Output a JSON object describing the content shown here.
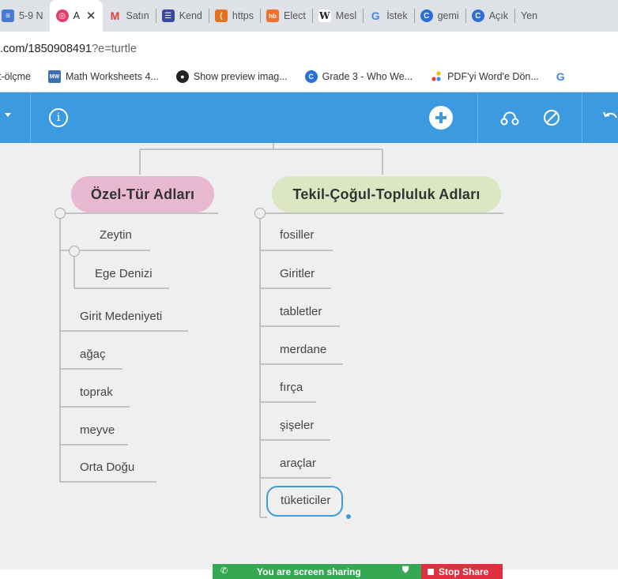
{
  "browser": {
    "tabs": [
      {
        "label": "5-9 N",
        "icon": "doc-icon",
        "color": "#4a7ad8"
      },
      {
        "label": "A",
        "icon": "app-icon",
        "color": "#e23d6a",
        "active": true
      },
      {
        "label": "Satın",
        "icon": "gmail-icon",
        "color": "#db4437"
      },
      {
        "label": "Kend",
        "icon": "forms-icon",
        "color": "#3b4aa0"
      },
      {
        "label": "https",
        "icon": "page-icon",
        "color": "#e8711c"
      },
      {
        "label": "Elect",
        "icon": "hb-icon",
        "color": "#f26f2b"
      },
      {
        "label": "Mesl",
        "icon": "w-icon",
        "color": "#ffffff"
      },
      {
        "label": "İstek",
        "icon": "google-icon",
        "color": "#4285f4"
      },
      {
        "label": "gemi",
        "icon": "chrome-c-icon",
        "color": "#2b6fd6"
      },
      {
        "label": "Açık",
        "icon": "chrome-c-icon",
        "color": "#2b6fd6"
      },
      {
        "label": "Yen",
        "icon": "",
        "color": ""
      }
    ],
    "tab_close": "✕",
    "url_main": ".com/1850908491",
    "url_rest": "?e=turtle",
    "bookmarks": [
      {
        "label": "t-ölçme",
        "icon": ""
      },
      {
        "label": "Math Worksheets 4...",
        "icon": "mw-icon"
      },
      {
        "label": "Show preview imag...",
        "icon": "github-icon"
      },
      {
        "label": "Grade 3 - Who We...",
        "icon": "chrome-c-icon"
      },
      {
        "label": "PDF'yi Word'e Dön...",
        "icon": "dots-icon"
      },
      {
        "label": "G",
        "icon": ""
      }
    ]
  },
  "toolbar": {
    "info": "i"
  },
  "mindmap": {
    "left_root": "Özel-Tür Adları",
    "right_root": "Tekil-Çoğul-Topluluk Adları",
    "left_sub": [
      "Zeytin",
      "Ege Denizi"
    ],
    "left_items": [
      "Girit Medeniyeti",
      "ağaç",
      "toprak",
      "meyve",
      "Orta Doğu"
    ],
    "right_items": [
      "fosiller",
      "Giritler",
      "tabletler",
      "merdane",
      "fırça",
      "şişeler",
      "araçlar",
      "tüketiciler"
    ],
    "colors": {
      "left_root": "#e7b8d0",
      "right_root": "#dbe7c2",
      "accent": "#3c9be0"
    }
  },
  "share_bar": {
    "message": "You are screen sharing",
    "stop": "Stop Share"
  }
}
